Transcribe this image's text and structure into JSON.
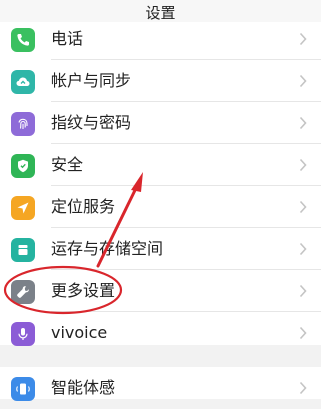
{
  "header": {
    "title": "设置"
  },
  "items": [
    {
      "label": "电话",
      "icon": "phone-icon",
      "color": "#3ac060"
    },
    {
      "label": "帐户与同步",
      "icon": "cloud-sync-icon",
      "color": "#2fb6a8"
    },
    {
      "label": "指纹与密码",
      "icon": "fingerprint-icon",
      "color": "#8e6bd8"
    },
    {
      "label": "安全",
      "icon": "shield-icon",
      "color": "#2fb556"
    },
    {
      "label": "定位服务",
      "icon": "location-icon",
      "color": "#f5a623"
    },
    {
      "label": "运存与存储空间",
      "icon": "storage-icon",
      "color": "#25b3a0"
    },
    {
      "label": "更多设置",
      "icon": "wrench-icon",
      "color": "#7b8189"
    },
    {
      "label": "vivoice",
      "icon": "microphone-icon",
      "color": "#8b5cd6"
    }
  ],
  "items2": [
    {
      "label": "智能体感",
      "icon": "motion-icon",
      "color": "#3c8be8"
    }
  ],
  "annotation": {
    "color": "#d9262c"
  }
}
